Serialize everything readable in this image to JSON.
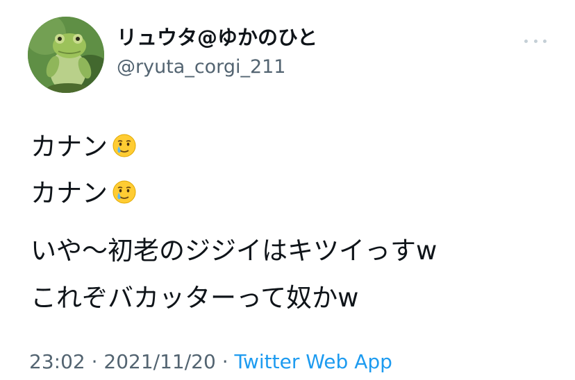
{
  "tweet": {
    "display_name": "リュウタ@ゆかのひと",
    "handle": "@ryuta_corgi_211",
    "lines": [
      "カナン",
      "カナン",
      "いや〜初老のジジイはキツイっすw",
      "これぞバカッターって奴かw"
    ],
    "emoji_name": "face-holding-back-tears-emoji",
    "time": "23:02",
    "separator": " · ",
    "date": "2021/11/20",
    "source": "Twitter Web App"
  },
  "colors": {
    "text": "#0f1419",
    "secondary": "#536471",
    "link": "#1d9bf0",
    "dots": "#c4cfd6"
  },
  "icons": {
    "avatar": "frog-avatar",
    "more": "more-options-icon"
  }
}
